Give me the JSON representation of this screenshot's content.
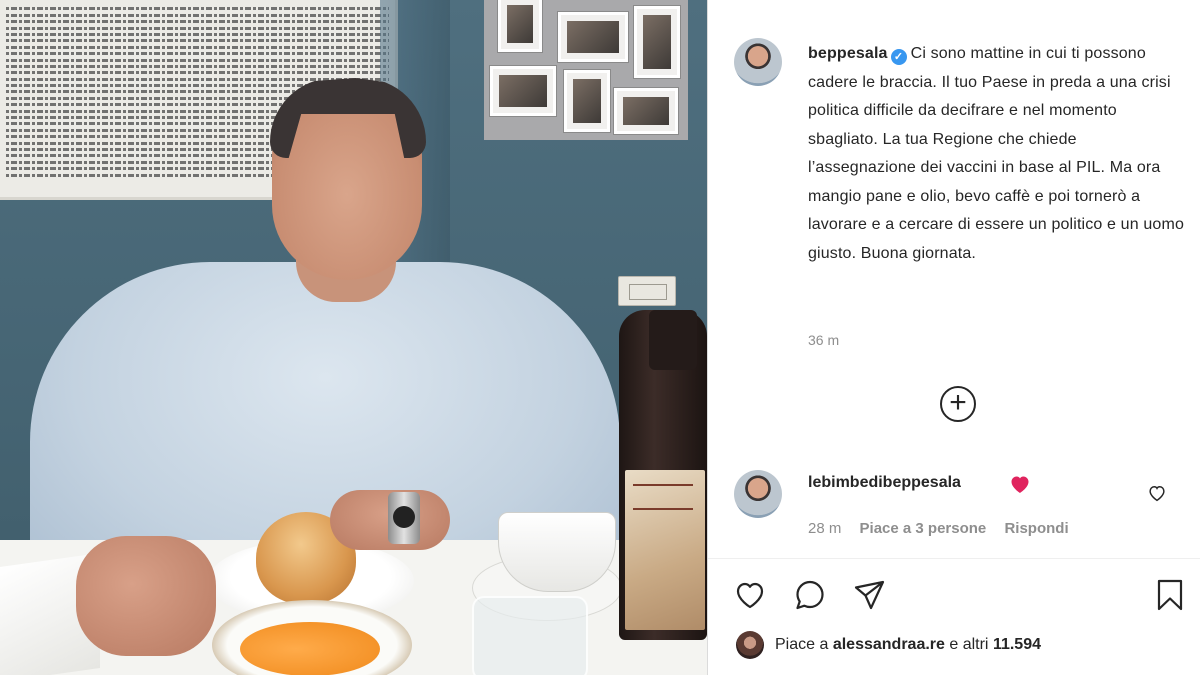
{
  "post": {
    "username": "beppesala",
    "caption": "Ci sono mattine in cui ti possono cadere le braccia. Il tuo Paese in preda a una crisi politica difficile da decifrare e nel momento sbagliato. La tua Regione che chiede l’assegnazione dei vaccini in base al PIL. Ma ora mangio pane e olio, bevo caffè e poi tornerò a lavorare e a cercare di essere un politico e un uomo giusto. Buona giornata.",
    "time": "36 m",
    "load_more_symbol": "+"
  },
  "comment": {
    "username": "lebimbedibeppesala",
    "time": "28 m",
    "likes": "Piace a 3 persone",
    "reply": "Rispondi",
    "emoji_icon": "red-heart-emoji"
  },
  "likes": {
    "prefix": "Piace a",
    "user": "alessandraa.re",
    "connector": "e altri",
    "count": "11.594"
  },
  "actions": {
    "icons": [
      "heart-icon",
      "comment-icon",
      "share-icon",
      "bookmark-icon"
    ]
  },
  "colors": {
    "verified": "#3897f0",
    "text": "#262626",
    "muted": "#8e8e8e",
    "heart_emoji": "#e0245e"
  }
}
